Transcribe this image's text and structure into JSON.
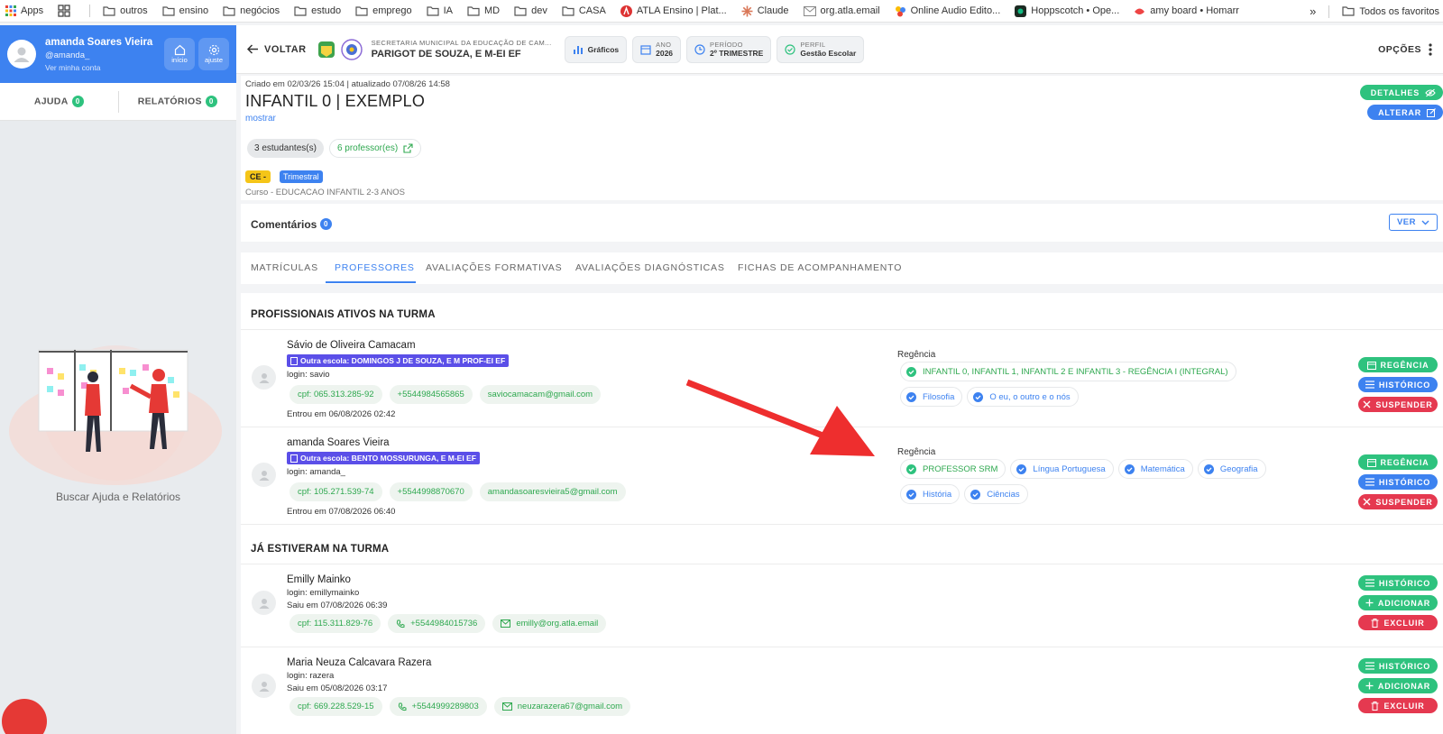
{
  "bookmarks": {
    "items": [
      "Apps",
      "outros",
      "ensino",
      "negócios",
      "estudo",
      "emprego",
      "IA",
      "MD",
      "dev",
      "CASA",
      "ATLA Ensino | Plat...",
      "Claude",
      "org.atla.email",
      "Online Audio Edito...",
      "Hoppscotch • Ope...",
      "amy board • Homarr"
    ],
    "more": "»",
    "favorites": "Todos os favoritos"
  },
  "sidebar": {
    "user_name": "amanda Soares Vieira",
    "user_handle": "@amanda_",
    "user_link": "Ver minha conta",
    "btn_inicio": "início",
    "btn_ajuste": "ajuste",
    "tab_ajuda": "AJUDA",
    "tab_ajuda_count": "0",
    "tab_relatorios": "RELATÓRIOS",
    "tab_relatorios_count": "0",
    "help_text": "Buscar Ajuda e Relatórios"
  },
  "topbar": {
    "back": "VOLTAR",
    "school_sub": "SECRETARIA MUNICIPAL DA EDUCAÇÃO DE CAM...",
    "school_name": "PARIGOT DE SOUZA, E M-EI EF",
    "graficos": "Gráficos",
    "ano_label": "ANO",
    "ano_value": "2026",
    "periodo_label": "PERÍODO",
    "periodo_value": "2º TRIMESTRE",
    "perfil_label": "PERFIL",
    "perfil_value": "Gestão Escolar",
    "opcoes": "OPÇÕES"
  },
  "turma": {
    "meta": "Criado em 02/03/26 15:04 | atualizado 07/08/26 14:58",
    "title": "INFANTIL 0 | EXEMPLO",
    "mostrar": "mostrar",
    "estudantes": "3 estudantes(s)",
    "professores": "6 professor(es)",
    "tag_ce": "CE -",
    "tag_tri": "Trimestral",
    "curso": "Curso - EDUCACAO INFANTIL 2-3 ANOS",
    "btn_detalhes": "DETALHES",
    "btn_alterar": "ALTERAR"
  },
  "comentarios": {
    "title": "Comentários",
    "count": "0",
    "ver": "VER"
  },
  "tabs": [
    "MATRÍCULAS",
    "PROFESSORES",
    "AVALIAÇÕES FORMATIVAS",
    "AVALIAÇÕES DIAGNÓSTICAS",
    "FICHAS DE ACOMPANHAMENTO"
  ],
  "ativos": {
    "title": "PROFISSIONAIS ATIVOS NA TURMA",
    "people": [
      {
        "name": "Sávio de Oliveira Camacam",
        "school": "Outra escola: DOMINGOS J DE SOUZA, E M PROF-EI EF",
        "login": "login: savio",
        "cpf": "cpf: 065.313.285-92",
        "phone": "+5544984565865",
        "email": "saviocamacam@gmail.com",
        "date": "Entrou em 06/08/2026 02:42",
        "reg_label": "Regência",
        "reg_main": "INFANTIL 0, INFANTIL 1, INFANTIL 2 E INFANTIL 3 - REGÊNCIA I (INTEGRAL)",
        "reg_subs": [
          "Filosofia",
          "O eu, o outro e o nós"
        ]
      },
      {
        "name": "amanda Soares Vieira",
        "school": "Outra escola: BENTO MOSSURUNGA, E M-EI EF",
        "login": "login: amanda_",
        "cpf": "cpf: 105.271.539-74",
        "phone": "+5544998870670",
        "email": "amandasoaresvieira5@gmail.com",
        "date": "Entrou em 07/08/2026 06:40",
        "reg_label": "Regência",
        "reg_main": "PROFESSOR SRM",
        "reg_subs": [
          "Língua Portuguesa",
          "Matemática",
          "Geografia",
          "História",
          "Ciências"
        ]
      }
    ],
    "btn_regencia": "REGÊNCIA",
    "btn_historico": "HISTÓRICO",
    "btn_suspender": "SUSPENDER"
  },
  "antigos": {
    "title": "JÁ ESTIVERAM NA TURMA",
    "people": [
      {
        "name": "Emilly Mainko",
        "login": "login: emillymainko",
        "date": "Saiu em 07/08/2026 06:39",
        "cpf": "cpf: 115.311.829-76",
        "phone": "+5544984015736",
        "email": "emilly@org.atla.email"
      },
      {
        "name": "Maria Neuza Calcavara Razera",
        "login": "login: razera",
        "date": "Saiu em 05/08/2026 03:17",
        "cpf": "cpf: 669.228.529-15",
        "phone": "+5544999289803",
        "email": "neuzarazera67@gmail.com"
      }
    ],
    "btn_historico": "HISTÓRICO",
    "btn_adicionar": "ADICIONAR",
    "btn_excluir": "EXCLUIR"
  },
  "colors": {
    "primary": "#3d82f0",
    "success": "#2ec27e",
    "danger": "#e53950",
    "arrow": "#ee2e2e"
  }
}
